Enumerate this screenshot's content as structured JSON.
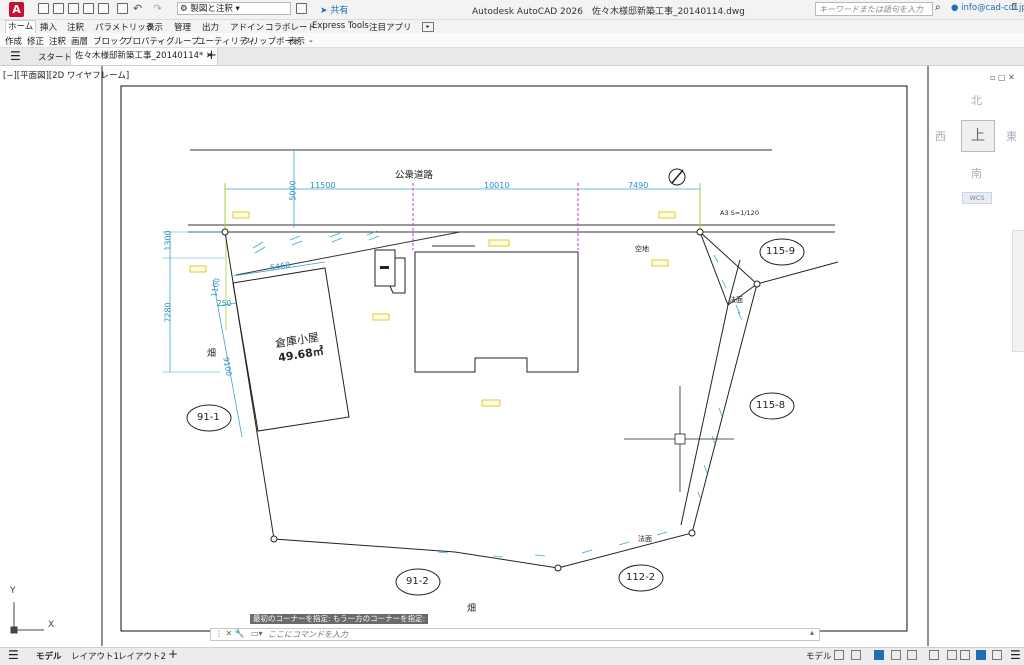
{
  "app": {
    "title": "Autodesk AutoCAD 2026　佐々木様邸新築工事_20140114.dwg",
    "logo_letter": "A",
    "workspace": "製図と注釈",
    "share": "共有",
    "search_placeholder": "キーワードまたは語句を入力",
    "user": "info@cad-cdi.jp"
  },
  "ribbon_tabs": [
    "ホーム",
    "挿入",
    "注釈",
    "パラメトリック",
    "表示",
    "管理",
    "出力",
    "アドイン",
    "コラボレート",
    "Express Tools",
    "注目アプリ"
  ],
  "ribbon_panels": [
    "作成",
    "修正",
    "注釈",
    "画層",
    "ブロック",
    "プロパティ",
    "グループ",
    "ユーティリティ",
    "クリップボード",
    "表示"
  ],
  "file_tabs": {
    "start": "スタート",
    "active": "佐々木様邸新築工事_20140114*"
  },
  "viewport_label": "[−][平面図][2D ワイヤフレーム]",
  "viewcube": {
    "north": "北",
    "south": "南",
    "east": "東",
    "west": "西",
    "top": "上",
    "wcs": "WCS"
  },
  "drawing": {
    "road": "公衆道路",
    "scale": "A3 S=1/120",
    "dims": {
      "d1": "11500",
      "d2": "10010",
      "d3": "7490",
      "d4": "5000",
      "d5": "1300",
      "d6": "7280",
      "d7": "5460",
      "d8": "1100",
      "d9": "250",
      "d10": "9100"
    },
    "shed_name": "倉庫小屋",
    "shed_area": "49.68㎡",
    "field1": "畑",
    "field2": "畑",
    "vacant": "空地",
    "slope1": "法面",
    "slope2": "法面",
    "parcels": [
      "91-1",
      "91-2",
      "112-2",
      "115-8",
      "115-9"
    ]
  },
  "command": {
    "history": "最初のコーナーを指定: もう一方のコーナーを指定:",
    "placeholder": "ここにコマンドを入力"
  },
  "layout_tabs": [
    "モデル",
    "レイアウト1",
    "レイアウト2"
  ],
  "status_model": "モデル"
}
